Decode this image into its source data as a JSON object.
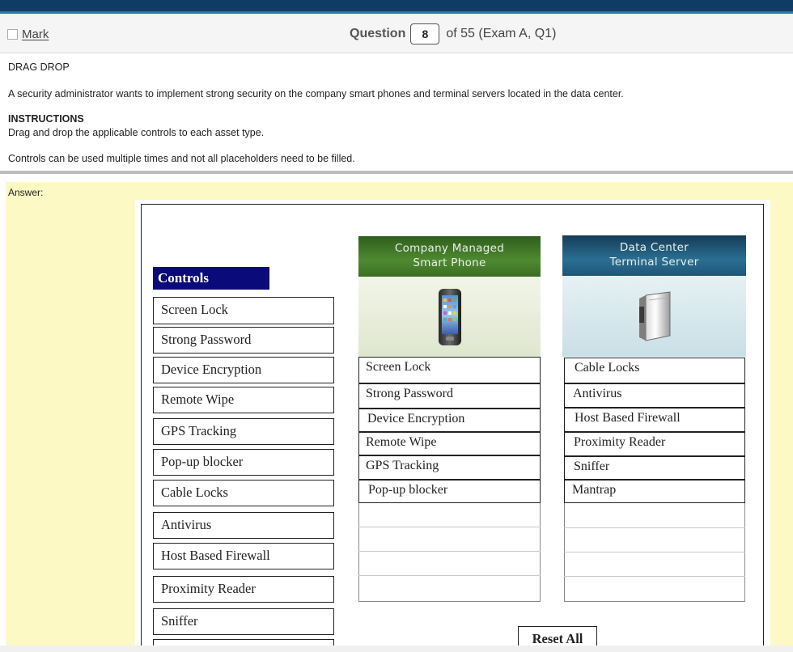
{
  "header": {
    "mark_label": "Mark",
    "question_word": "Question",
    "question_number": "8",
    "question_of": "of 55 (Exam A, Q1)"
  },
  "question": {
    "type": "DRAG DROP",
    "text": "A security administrator wants to implement strong security on the company smart phones and terminal servers located in the data center.",
    "instructions_heading": "INSTRUCTIONS",
    "instructions_text": "Drag and drop the applicable controls to each asset type.",
    "note": "Controls can be used multiple times and not all placeholders need to be filled."
  },
  "answer": {
    "label": "Answer:",
    "controls_title": "Controls",
    "controls": [
      "Screen Lock",
      "Strong Password",
      "Device Encryption",
      "Remote Wipe",
      "GPS Tracking",
      "Pop-up blocker",
      "Cable Locks",
      "Antivirus",
      "Host Based Firewall",
      "Proximity Reader",
      "Sniffer"
    ],
    "phone": {
      "heading_line1": "Company Managed",
      "heading_line2": "Smart Phone",
      "icon": "smartphone-icon",
      "items": [
        "Screen Lock",
        "Strong Password",
        "Device Encryption",
        "Remote Wipe",
        "GPS Tracking",
        "Pop-up blocker"
      ]
    },
    "server": {
      "heading_line1": "Data Center",
      "heading_line2": "Terminal Server",
      "icon": "server-tower-icon",
      "items": [
        "Cable Locks",
        "Antivirus",
        "Host Based Firewall",
        "Proximity Reader",
        "Sniffer",
        "Mantrap"
      ]
    },
    "reset_label": "Reset All"
  },
  "colors": {
    "topbar": "#0f3c64",
    "answer_background": "#fdf9c4",
    "controls_title_background": "#0a0a7a"
  }
}
